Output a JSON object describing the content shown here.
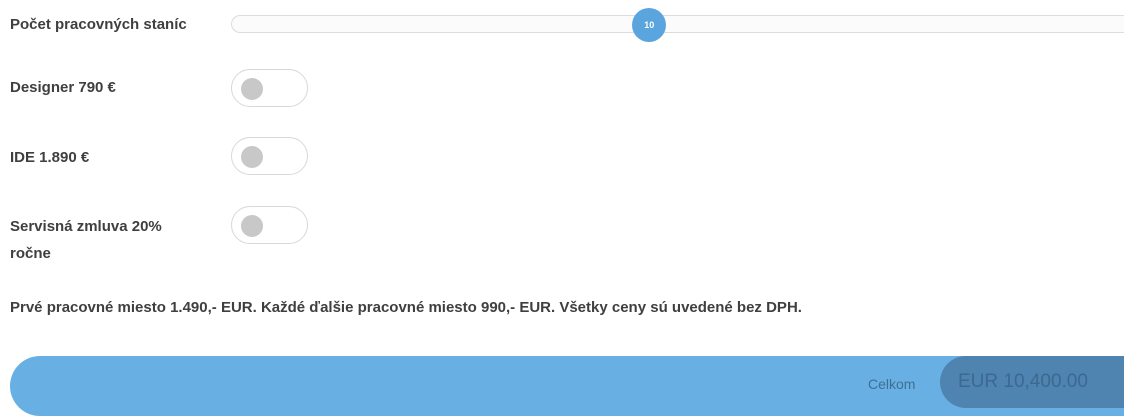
{
  "stations": {
    "label": "Počet pracovných staníc",
    "value": "10",
    "fraction": 0.47
  },
  "options": [
    {
      "label": "Designer 790 €",
      "enabled": false
    },
    {
      "label": "IDE 1.890 €",
      "enabled": false
    },
    {
      "label": "Servisná zmluva 20% ročne",
      "enabled": false
    }
  ],
  "note": "Prvé pracovné miesto 1.490,- EUR. Každé ďalšie pracovné miesto 990,- EUR. Všetky ceny sú uvedené bez DPH.",
  "total": {
    "label": "Celkom",
    "value": "EUR 10,400.00"
  },
  "colors": {
    "accent": "#5aa5de",
    "bar": "#68b0e3",
    "total_pill": "#4f83b0"
  }
}
